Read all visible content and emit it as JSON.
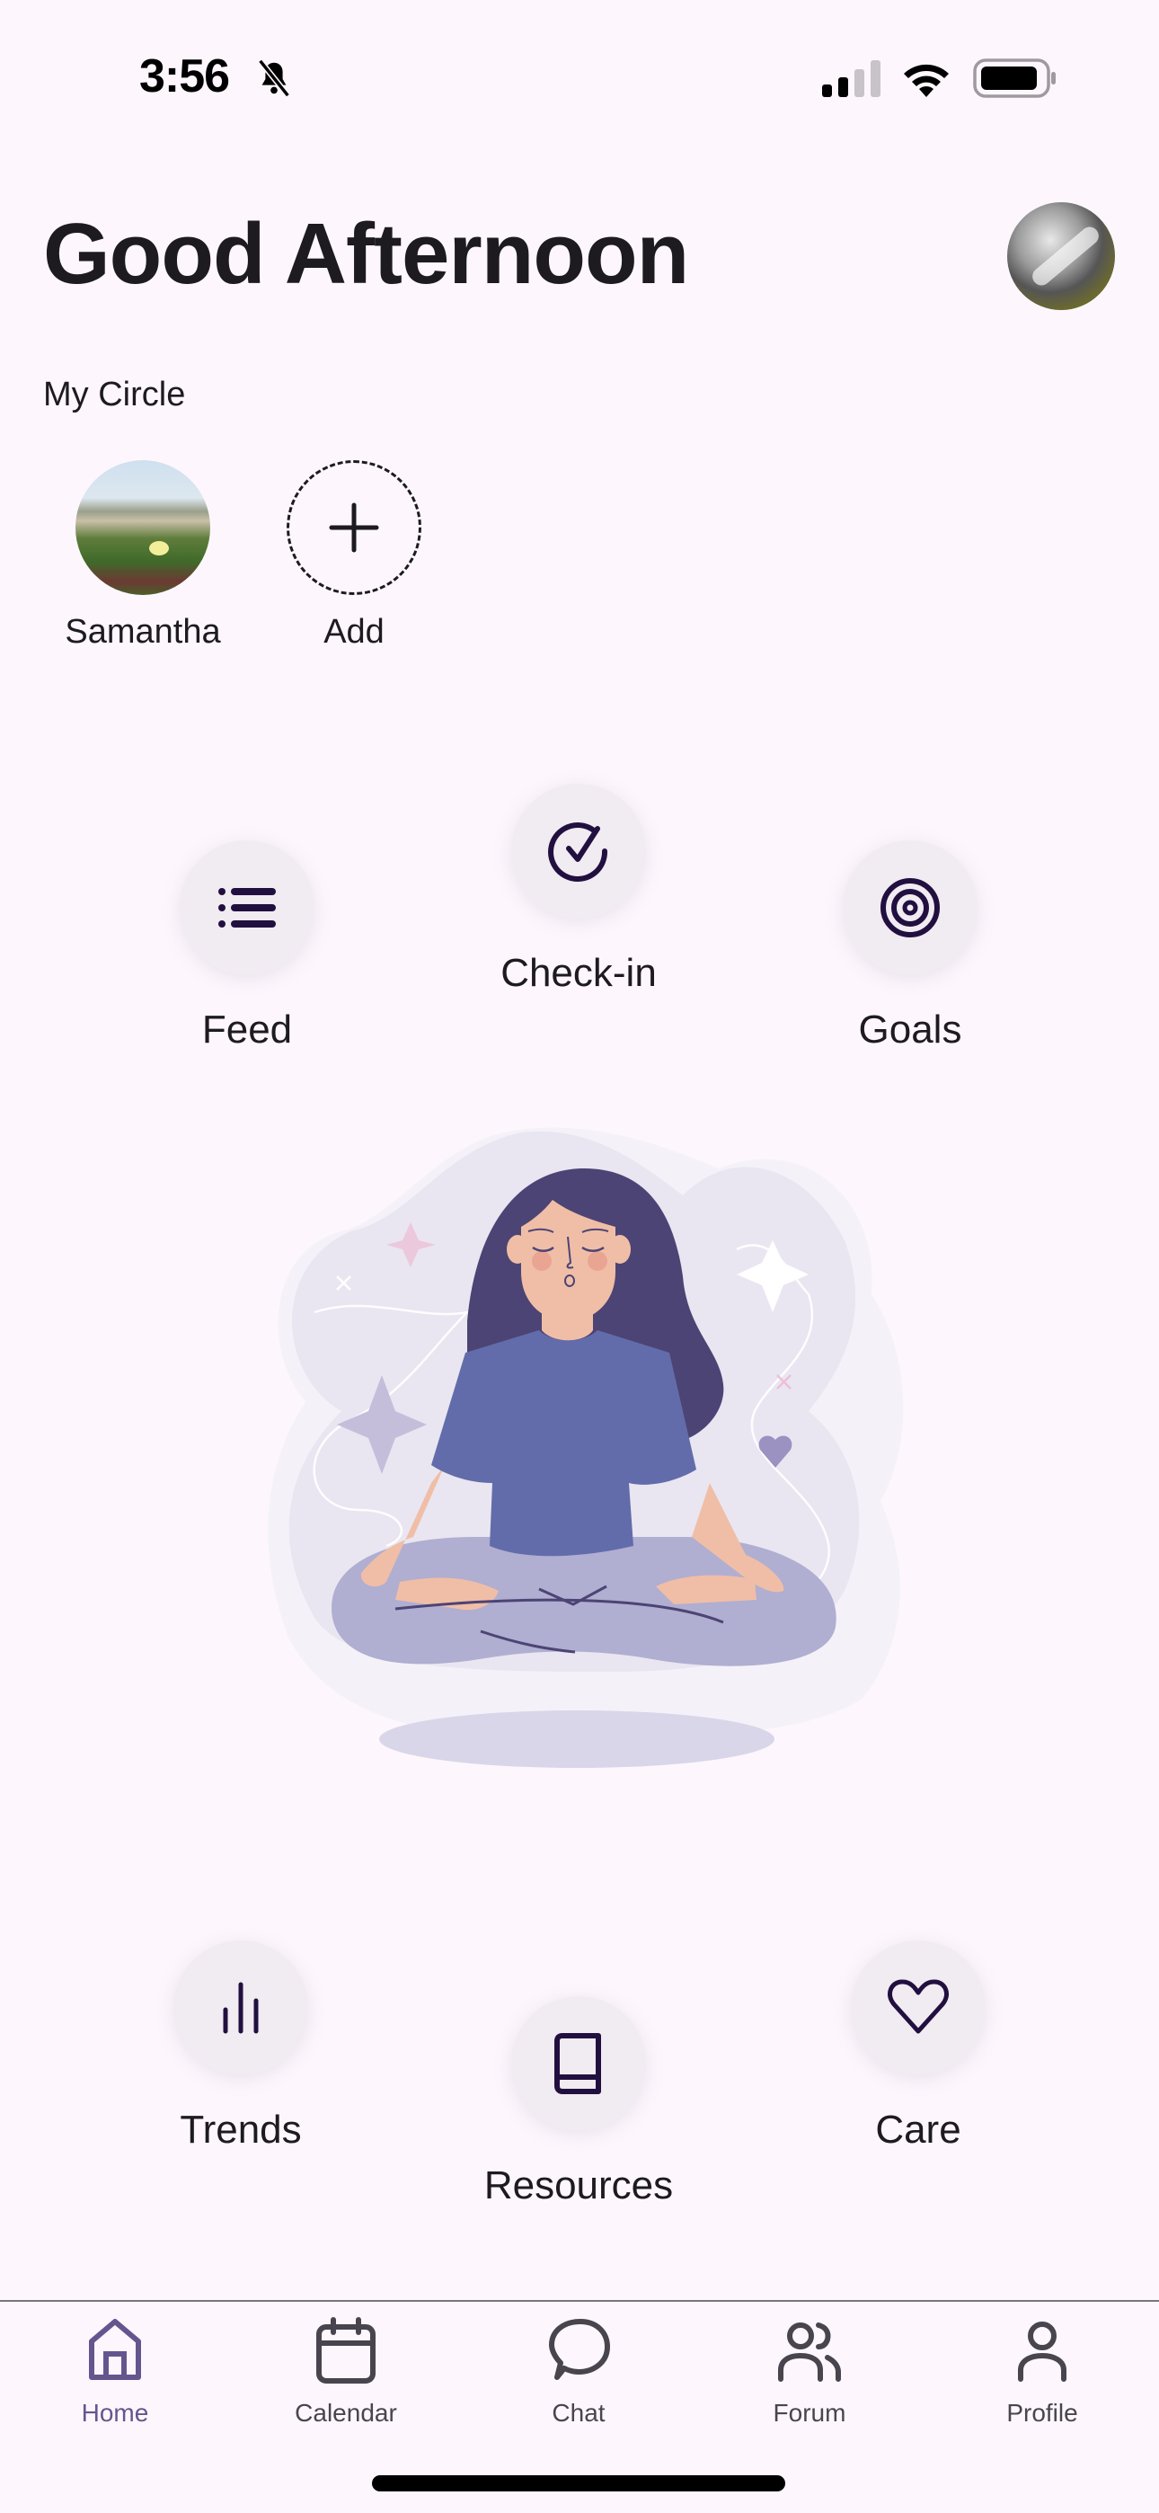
{
  "status_bar": {
    "time": "3:56",
    "icons": [
      "bell-slash-icon",
      "cellular-signal-icon",
      "wifi-icon",
      "battery-icon"
    ]
  },
  "header": {
    "greeting": "Good Afternoon",
    "profile_avatar": "user-profile-photo"
  },
  "my_circle": {
    "label": "My Circle",
    "members": [
      {
        "name": "Samantha",
        "avatar": "photo"
      }
    ],
    "add_label": "Add"
  },
  "actions_top": [
    {
      "label": "Feed",
      "icon": "list-icon"
    },
    {
      "label": "Check-in",
      "icon": "check-circle-icon"
    },
    {
      "label": "Goals",
      "icon": "target-icon"
    }
  ],
  "illustration": "meditating-woman-illustration",
  "actions_bottom": [
    {
      "label": "Trends",
      "icon": "bar-chart-icon"
    },
    {
      "label": "Resources",
      "icon": "book-icon"
    },
    {
      "label": "Care",
      "icon": "heart-icon"
    }
  ],
  "bottom_nav": {
    "active": "Home",
    "items": [
      {
        "label": "Home",
        "icon": "home-icon"
      },
      {
        "label": "Calendar",
        "icon": "calendar-icon"
      },
      {
        "label": "Chat",
        "icon": "chat-bubble-icon"
      },
      {
        "label": "Forum",
        "icon": "people-icon"
      },
      {
        "label": "Profile",
        "icon": "person-icon"
      }
    ]
  },
  "colors": {
    "background": "#fdf7fd",
    "text": "#1d1b20",
    "icon_dark": "#21103f",
    "accent": "#65558f",
    "button_bg": "#f1ebf2",
    "nav_inactive": "#49454f"
  }
}
